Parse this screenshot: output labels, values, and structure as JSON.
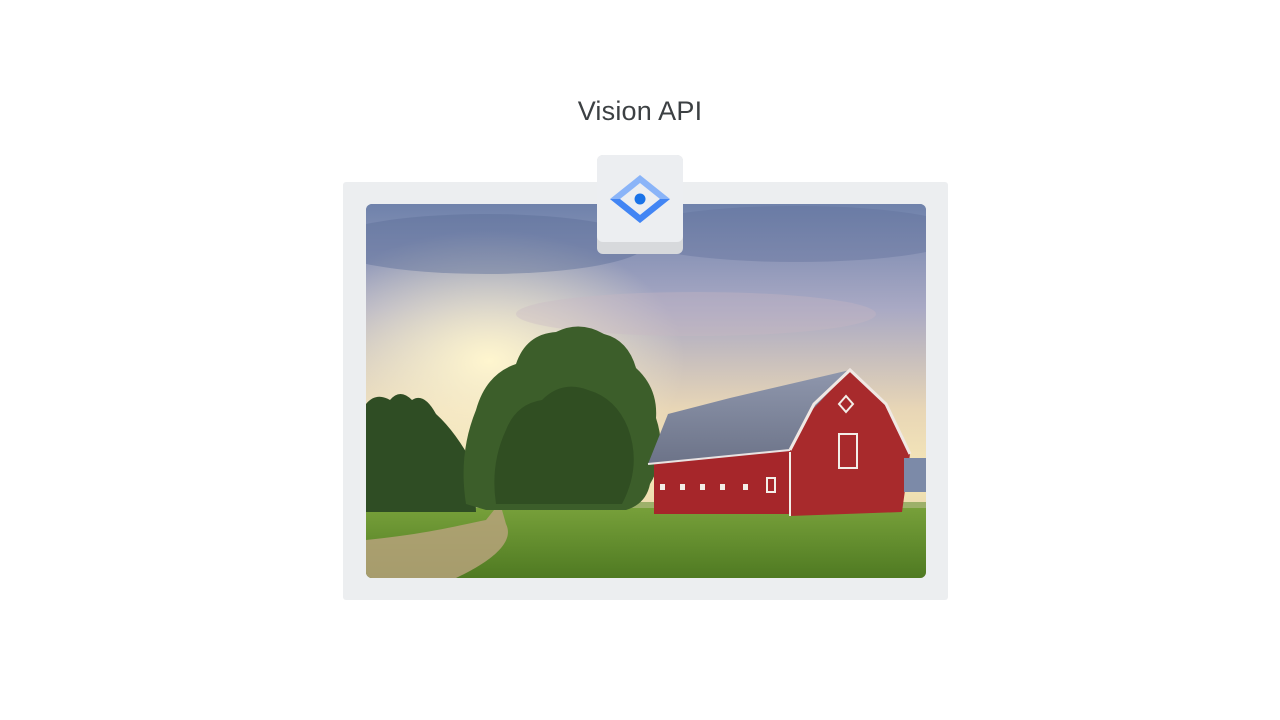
{
  "header": {
    "title": "Vision API"
  },
  "product_badge": {
    "icon": "vision-api-icon",
    "colors": {
      "blue_light": "#8ab4f8",
      "blue": "#4285f4",
      "blue_dark": "#1a73e8"
    }
  },
  "image": {
    "subject": "red-barn-photo",
    "colors": {
      "barn_red": "#a6262a",
      "grass": "#5f8a2c",
      "sky": "#8e9cbe"
    }
  }
}
